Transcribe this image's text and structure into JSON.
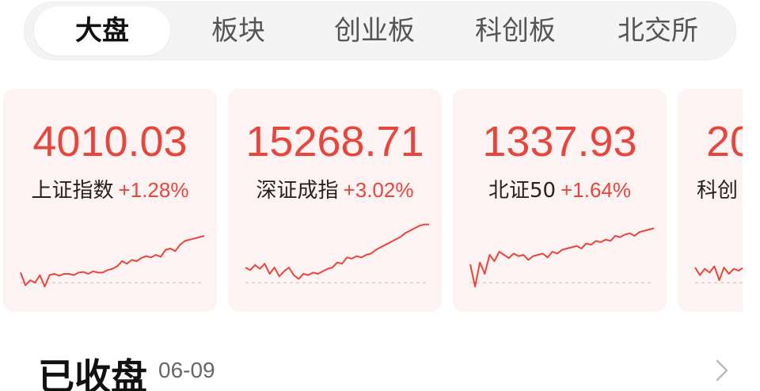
{
  "tabs": [
    {
      "label": "大盘",
      "active": true
    },
    {
      "label": "板块",
      "active": false
    },
    {
      "label": "创业板",
      "active": false
    },
    {
      "label": "科创板",
      "active": false
    },
    {
      "label": "北交所",
      "active": false
    }
  ],
  "cards": [
    {
      "value": "4010.03",
      "name": "上证指数",
      "change": "+1.28%",
      "trend": [
        0.22,
        0.02,
        0.1,
        0.06,
        0.18,
        0.0,
        0.18,
        0.2,
        0.17,
        0.2,
        0.2,
        0.18,
        0.22,
        0.23,
        0.2,
        0.24,
        0.22,
        0.22,
        0.26,
        0.28,
        0.32,
        0.4,
        0.36,
        0.42,
        0.4,
        0.45,
        0.48,
        0.46,
        0.5,
        0.47,
        0.58,
        0.6,
        0.56,
        0.66,
        0.72,
        0.74,
        0.76,
        0.78,
        0.8
      ]
    },
    {
      "value": "15268.71",
      "name": "深证成指",
      "change": "+3.02%",
      "trend": [
        0.3,
        0.26,
        0.34,
        0.28,
        0.36,
        0.2,
        0.3,
        0.16,
        0.24,
        0.3,
        0.18,
        0.12,
        0.2,
        0.18,
        0.22,
        0.2,
        0.24,
        0.28,
        0.3,
        0.38,
        0.36,
        0.46,
        0.44,
        0.48,
        0.46,
        0.5,
        0.52,
        0.58,
        0.62,
        0.66,
        0.7,
        0.74,
        0.78,
        0.84,
        0.88,
        0.92,
        0.96,
        0.98,
        0.98
      ]
    },
    {
      "value": "1337.93",
      "name": "北证50",
      "change": "+1.64%",
      "trend": [
        0.35,
        0.0,
        0.38,
        0.2,
        0.5,
        0.4,
        0.55,
        0.5,
        0.45,
        0.52,
        0.48,
        0.5,
        0.42,
        0.48,
        0.5,
        0.52,
        0.46,
        0.55,
        0.52,
        0.58,
        0.6,
        0.62,
        0.64,
        0.6,
        0.68,
        0.66,
        0.72,
        0.7,
        0.74,
        0.72,
        0.8,
        0.78,
        0.82,
        0.84,
        0.8,
        0.86,
        0.88,
        0.9,
        0.92
      ]
    },
    {
      "value": "20",
      "name": "科创",
      "change": "",
      "trend": [
        0.3,
        0.18,
        0.28,
        0.22,
        0.32,
        0.1,
        0.3,
        0.2,
        0.28,
        0.25,
        0.3,
        0.18,
        0.28,
        0.32,
        0.26,
        0.3,
        0.2,
        0.28,
        0.3,
        0.32
      ]
    }
  ],
  "status": {
    "title": "已收盘",
    "date": "06-09"
  },
  "colors": {
    "up": "#e8453c",
    "card_bg": "#fdf3f3",
    "tab_bg": "#f4f4f4"
  },
  "icons": {
    "more": "chevron-right-icon"
  }
}
